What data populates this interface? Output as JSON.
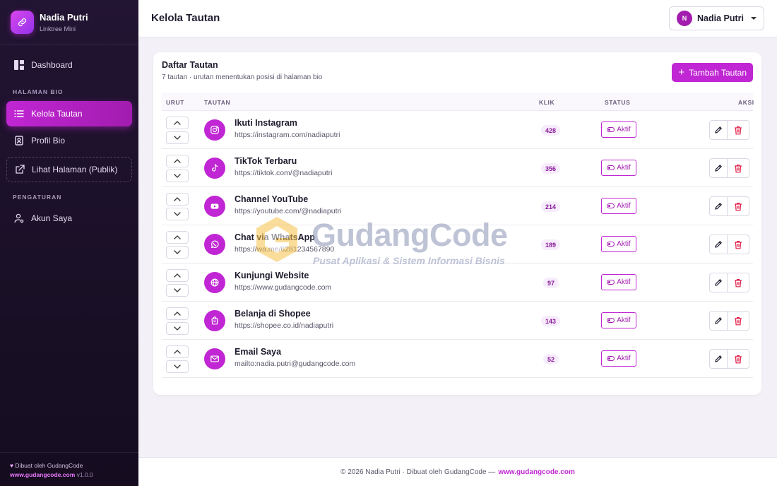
{
  "brand": {
    "name": "Nadia Putri",
    "subtitle": "Linktree Mini"
  },
  "sidebar": {
    "dashboard": "Dashboard",
    "section_bio": "HALAMAN BIO",
    "kelola": "Kelola Tautan",
    "profil": "Profil Bio",
    "lihat": "Lihat Halaman (Publik)",
    "section_settings": "PENGATURAN",
    "akun": "Akun Saya",
    "footer_made": "Dibuat oleh GudangCode",
    "footer_site": "www.gudangcode.com",
    "footer_version": "v1.0.0"
  },
  "header": {
    "title": "Kelola Tautan",
    "user_initial": "N",
    "user_name": "Nadia Putri"
  },
  "card": {
    "title": "Daftar Tautan",
    "subtitle": "7 tautan · urutan menentukan posisi di halaman bio",
    "add_label": "Tambah Tautan"
  },
  "table": {
    "headers": {
      "order": "URUT",
      "link": "TAUTAN",
      "clicks": "KLIK",
      "status": "STATUS",
      "actions": "AKSI"
    },
    "rows": [
      {
        "icon": "instagram-icon",
        "title": "Ikuti Instagram",
        "url": "https://instagram.com/nadiaputri",
        "clicks": "428",
        "status": "Aktif"
      },
      {
        "icon": "tiktok-icon",
        "title": "TikTok Terbaru",
        "url": "https://tiktok.com/@nadiaputri",
        "clicks": "356",
        "status": "Aktif"
      },
      {
        "icon": "youtube-icon",
        "title": "Channel YouTube",
        "url": "https://youtube.com/@nadiaputri",
        "clicks": "214",
        "status": "Aktif"
      },
      {
        "icon": "whatsapp-icon",
        "title": "Chat via WhatsApp",
        "url": "https://wa.me/6281234567890",
        "clicks": "189",
        "status": "Aktif"
      },
      {
        "icon": "globe-icon",
        "title": "Kunjungi Website",
        "url": "https://www.gudangcode.com",
        "clicks": "97",
        "status": "Aktif"
      },
      {
        "icon": "shopping-bag-icon",
        "title": "Belanja di Shopee",
        "url": "https://shopee.co.id/nadiaputri",
        "clicks": "143",
        "status": "Aktif"
      },
      {
        "icon": "mail-icon",
        "title": "Email Saya",
        "url": "mailto:nadia.putri@gudangcode.com",
        "clicks": "52",
        "status": "Aktif"
      }
    ]
  },
  "footer": {
    "text": "© 2026 Nadia Putri · Dibuat oleh GudangCode —",
    "site": "www.gudangcode.com"
  },
  "watermark": {
    "title": "GudangCode",
    "subtitle": "Pusat Aplikasi & Sistem Informasi Bisnis"
  },
  "colors": {
    "accent": "#c026d3",
    "sidebar_bg": "#1a1027",
    "danger": "#e11d48"
  }
}
